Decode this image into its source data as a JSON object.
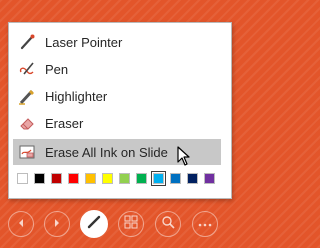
{
  "menu": {
    "items": [
      {
        "label": "Laser Pointer",
        "icon": "laser-pointer-icon"
      },
      {
        "label": "Pen",
        "icon": "pen-icon"
      },
      {
        "label": "Highlighter",
        "icon": "highlighter-icon"
      },
      {
        "label": "Eraser",
        "icon": "eraser-icon"
      },
      {
        "label": "Erase All Ink on Slide",
        "icon": "erase-all-ink-icon",
        "highlighted": true
      }
    ],
    "colors": [
      "#ffffff",
      "#000000",
      "#c00000",
      "#ff0000",
      "#ffc000",
      "#ffff00",
      "#92d050",
      "#00b050",
      "#00b0f0",
      "#0070c0",
      "#002060",
      "#7030a0"
    ],
    "selected_color": "#00b0f0"
  },
  "toolbar": {
    "buttons": [
      {
        "icon": "previous-slide-icon"
      },
      {
        "icon": "next-slide-icon"
      },
      {
        "icon": "pen-tools-icon",
        "active": true
      },
      {
        "icon": "see-all-slides-icon"
      },
      {
        "icon": "zoom-icon"
      },
      {
        "icon": "more-options-icon"
      }
    ]
  },
  "colors": {
    "background": "#e3552a",
    "highlight": "#c8c8c8"
  }
}
